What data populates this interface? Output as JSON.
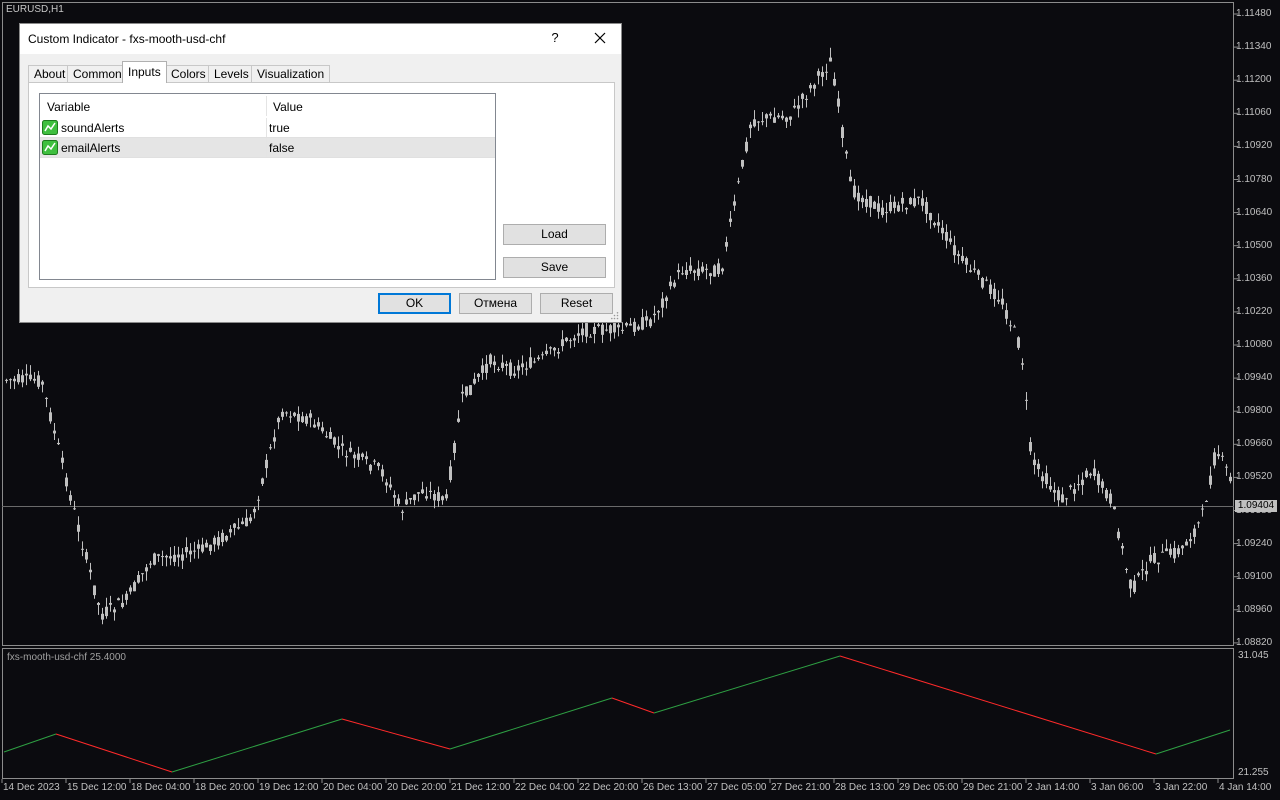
{
  "chart": {
    "symbol": "EURUSD,H1",
    "price_axis": [
      "1.11480",
      "1.11340",
      "1.11200",
      "1.11060",
      "1.10920",
      "1.10780",
      "1.10640",
      "1.10500",
      "1.10360",
      "1.10220",
      "1.10080",
      "1.09940",
      "1.09800",
      "1.09660",
      "1.09520",
      "1.09380",
      "1.09240",
      "1.09100",
      "1.08960",
      "1.08820"
    ],
    "current_price": "1.09404",
    "time_axis": [
      "14 Dec 2023",
      "15 Dec 12:00",
      "18 Dec 04:00",
      "18 Dec 20:00",
      "19 Dec 12:00",
      "20 Dec 04:00",
      "20 Dec 20:00",
      "21 Dec 12:00",
      "22 Dec 04:00",
      "22 Dec 20:00",
      "26 Dec 13:00",
      "27 Dec 05:00",
      "27 Dec 21:00",
      "28 Dec 13:00",
      "29 Dec 05:00",
      "29 Dec 21:00",
      "2 Jan 14:00",
      "3 Jan 06:00",
      "3 Jan 22:00",
      "4 Jan 14:00"
    ],
    "indicator_label": "fxs-mooth-usd-chf 25.4000",
    "indicator_max": "31.045",
    "indicator_min": "21.255",
    "candle_color": "#c0c0c0",
    "up_color": "#2ea043",
    "down_color": "#ff2a2a"
  },
  "dialog": {
    "title": "Custom Indicator - fxs-mooth-usd-chf",
    "help_label": "?",
    "tabs": [
      {
        "label": "About"
      },
      {
        "label": "Common"
      },
      {
        "label": "Inputs"
      },
      {
        "label": "Colors"
      },
      {
        "label": "Levels"
      },
      {
        "label": "Visualization"
      }
    ],
    "active_tab": "Inputs",
    "grid": {
      "col_variable": "Variable",
      "col_value": "Value",
      "rows": [
        {
          "variable": "soundAlerts",
          "value": "true"
        },
        {
          "variable": "emailAlerts",
          "value": "false"
        }
      ]
    },
    "load_label": "Load",
    "save_label": "Save",
    "ok_label": "OK",
    "cancel_label": "Отмена",
    "reset_label": "Reset"
  }
}
